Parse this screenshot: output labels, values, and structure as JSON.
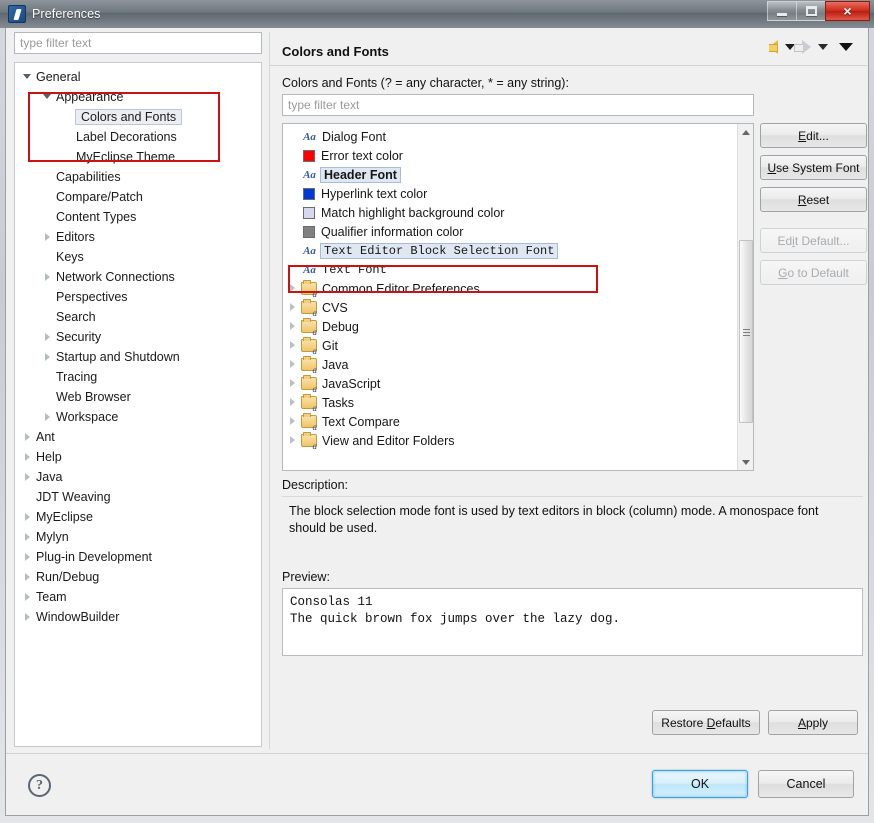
{
  "window": {
    "title": "Preferences",
    "icon": "eclipse-preferences-icon",
    "controls": {
      "minimize": "minimize-button",
      "maximize": "maximize-button",
      "close": "×"
    }
  },
  "sidebar": {
    "filter_placeholder": "type filter text",
    "filter_value": "",
    "items": [
      {
        "label": "General",
        "indent": 0,
        "arrow": "expanded",
        "selected": false
      },
      {
        "label": "Appearance",
        "indent": 1,
        "arrow": "expanded",
        "selected": false
      },
      {
        "label": "Colors and Fonts",
        "indent": 2,
        "arrow": "none",
        "selected": true
      },
      {
        "label": "Label Decorations",
        "indent": 2,
        "arrow": "none",
        "selected": false
      },
      {
        "label": "MyEclipse Theme",
        "indent": 2,
        "arrow": "none",
        "selected": false
      },
      {
        "label": "Capabilities",
        "indent": 1,
        "arrow": "none",
        "selected": false
      },
      {
        "label": "Compare/Patch",
        "indent": 1,
        "arrow": "none",
        "selected": false
      },
      {
        "label": "Content Types",
        "indent": 1,
        "arrow": "none",
        "selected": false
      },
      {
        "label": "Editors",
        "indent": 1,
        "arrow": "collapsed",
        "selected": false
      },
      {
        "label": "Keys",
        "indent": 1,
        "arrow": "none",
        "selected": false
      },
      {
        "label": "Network Connections",
        "indent": 1,
        "arrow": "collapsed",
        "selected": false
      },
      {
        "label": "Perspectives",
        "indent": 1,
        "arrow": "none",
        "selected": false
      },
      {
        "label": "Search",
        "indent": 1,
        "arrow": "none",
        "selected": false
      },
      {
        "label": "Security",
        "indent": 1,
        "arrow": "collapsed",
        "selected": false
      },
      {
        "label": "Startup and Shutdown",
        "indent": 1,
        "arrow": "collapsed",
        "selected": false
      },
      {
        "label": "Tracing",
        "indent": 1,
        "arrow": "none",
        "selected": false
      },
      {
        "label": "Web Browser",
        "indent": 1,
        "arrow": "none",
        "selected": false
      },
      {
        "label": "Workspace",
        "indent": 1,
        "arrow": "collapsed",
        "selected": false
      },
      {
        "label": "Ant",
        "indent": 0,
        "arrow": "collapsed",
        "selected": false
      },
      {
        "label": "Help",
        "indent": 0,
        "arrow": "collapsed",
        "selected": false
      },
      {
        "label": "Java",
        "indent": 0,
        "arrow": "collapsed",
        "selected": false
      },
      {
        "label": "JDT Weaving",
        "indent": 0,
        "arrow": "none",
        "selected": false
      },
      {
        "label": "MyEclipse",
        "indent": 0,
        "arrow": "collapsed",
        "selected": false
      },
      {
        "label": "Mylyn",
        "indent": 0,
        "arrow": "collapsed",
        "selected": false
      },
      {
        "label": "Plug-in Development",
        "indent": 0,
        "arrow": "collapsed",
        "selected": false
      },
      {
        "label": "Run/Debug",
        "indent": 0,
        "arrow": "collapsed",
        "selected": false
      },
      {
        "label": "Team",
        "indent": 0,
        "arrow": "collapsed",
        "selected": false
      },
      {
        "label": "WindowBuilder",
        "indent": 0,
        "arrow": "collapsed",
        "selected": false
      }
    ]
  },
  "main": {
    "page_title": "Colors and Fonts",
    "nav": {
      "back_icon": "back-arrow-icon",
      "back_menu_icon": "chevron-down-icon",
      "forward_icon": "forward-arrow-icon",
      "forward_menu_icon": "chevron-down-icon",
      "overflow_icon": "chevron-down-icon"
    },
    "filter_label": "Colors and Fonts (? = any character, * = any string):",
    "filter_placeholder": "type filter text",
    "filter_value": "",
    "font_list": [
      {
        "label": "Dialog Font",
        "icon": "aa-font-icon",
        "style": "normal",
        "arrow": "none",
        "highlighted": false,
        "swatch": ""
      },
      {
        "label": "Error text color",
        "icon": "color-swatch",
        "style": "normal",
        "arrow": "none",
        "highlighted": false,
        "swatch": "#ff0000"
      },
      {
        "label": "Header Font",
        "icon": "aa-font-icon",
        "style": "bold",
        "arrow": "none",
        "highlighted": true,
        "swatch": ""
      },
      {
        "label": "Hyperlink text color",
        "icon": "color-swatch",
        "style": "normal",
        "arrow": "none",
        "highlighted": false,
        "swatch": "#0039d7"
      },
      {
        "label": "Match highlight background color",
        "icon": "color-swatch",
        "style": "normal",
        "arrow": "none",
        "highlighted": false,
        "swatch": "#d7d7ef"
      },
      {
        "label": "Qualifier information color",
        "icon": "color-swatch",
        "style": "normal",
        "arrow": "none",
        "highlighted": false,
        "swatch": "#808080"
      },
      {
        "label": "Text Editor Block Selection Font",
        "icon": "aa-font-icon",
        "style": "monospace",
        "arrow": "none",
        "highlighted": true,
        "swatch": ""
      },
      {
        "label": "Text Font",
        "icon": "aa-font-icon",
        "style": "monospace",
        "arrow": "none",
        "highlighted": false,
        "swatch": ""
      },
      {
        "label": "Common Editor Preferences",
        "icon": "folder-font-icon",
        "style": "normal",
        "arrow": "collapsed",
        "highlighted": false,
        "swatch": ""
      },
      {
        "label": "CVS",
        "icon": "folder-font-icon",
        "style": "normal",
        "arrow": "collapsed",
        "highlighted": false,
        "swatch": ""
      },
      {
        "label": "Debug",
        "icon": "folder-font-icon",
        "style": "normal",
        "arrow": "collapsed",
        "highlighted": false,
        "swatch": ""
      },
      {
        "label": "Git",
        "icon": "folder-font-icon",
        "style": "normal",
        "arrow": "collapsed",
        "highlighted": false,
        "swatch": ""
      },
      {
        "label": "Java",
        "icon": "folder-font-icon",
        "style": "normal",
        "arrow": "collapsed",
        "highlighted": false,
        "swatch": ""
      },
      {
        "label": "JavaScript",
        "icon": "folder-font-icon",
        "style": "normal",
        "arrow": "collapsed",
        "highlighted": false,
        "swatch": ""
      },
      {
        "label": "Tasks",
        "icon": "folder-font-icon",
        "style": "normal",
        "arrow": "collapsed",
        "highlighted": false,
        "swatch": ""
      },
      {
        "label": "Text Compare",
        "icon": "folder-font-icon",
        "style": "normal",
        "arrow": "collapsed",
        "highlighted": false,
        "swatch": ""
      },
      {
        "label": "View and Editor Folders",
        "icon": "folder-font-icon",
        "style": "normal",
        "arrow": "collapsed",
        "highlighted": false,
        "swatch": ""
      }
    ],
    "side_buttons": [
      {
        "label": "Edit...",
        "mnemonic": "E",
        "disabled": false
      },
      {
        "label": "Use System Font",
        "mnemonic": "U",
        "disabled": false
      },
      {
        "label": "Reset",
        "mnemonic": "R",
        "disabled": false
      },
      {
        "label": "Edit Default...",
        "mnemonic": "i",
        "disabled": true
      },
      {
        "label": "Go to Default",
        "mnemonic": "G",
        "disabled": true
      }
    ],
    "description_label": "Description:",
    "description_text": "The block selection mode font is used by text editors in block (column) mode. A monospace font should be used.",
    "preview_label": "Preview:",
    "preview_line1": "Consolas 11",
    "preview_line2": "The quick brown fox jumps over the lazy dog.",
    "restore_defaults_label": "Restore Defaults",
    "apply_label": "Apply"
  },
  "footer": {
    "help_icon": "help-question-icon",
    "ok_label": "OK",
    "cancel_label": "Cancel"
  },
  "colors": {
    "highlight_box": "#cc1111",
    "selection_bg": "#dfe8f2",
    "accent": "#3c9fd6"
  }
}
